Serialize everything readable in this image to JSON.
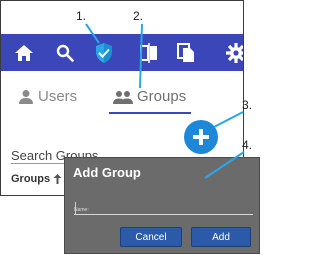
{
  "callouts": [
    "1.",
    "2.",
    "3.",
    "4."
  ],
  "topbar": {
    "color": "#3b46b8",
    "icons": [
      "home-icon",
      "search-icon",
      "shield-icon",
      "compare-icon",
      "copy-icon",
      "gear-icon"
    ]
  },
  "tabs": [
    {
      "label": "Users",
      "icon": "user-icon"
    },
    {
      "label": "Groups",
      "icon": "group-icon"
    }
  ],
  "search": {
    "label": "Search Groups"
  },
  "table": {
    "column_header": "Groups",
    "sort_icon": "arrow-up-icon"
  },
  "fab": {
    "icon": "plus-icon",
    "color": "#1e88d6"
  },
  "dialog": {
    "title": "Add Group",
    "field_label": "Name:",
    "field_value": "",
    "cancel_label": "Cancel",
    "add_label": "Add"
  }
}
